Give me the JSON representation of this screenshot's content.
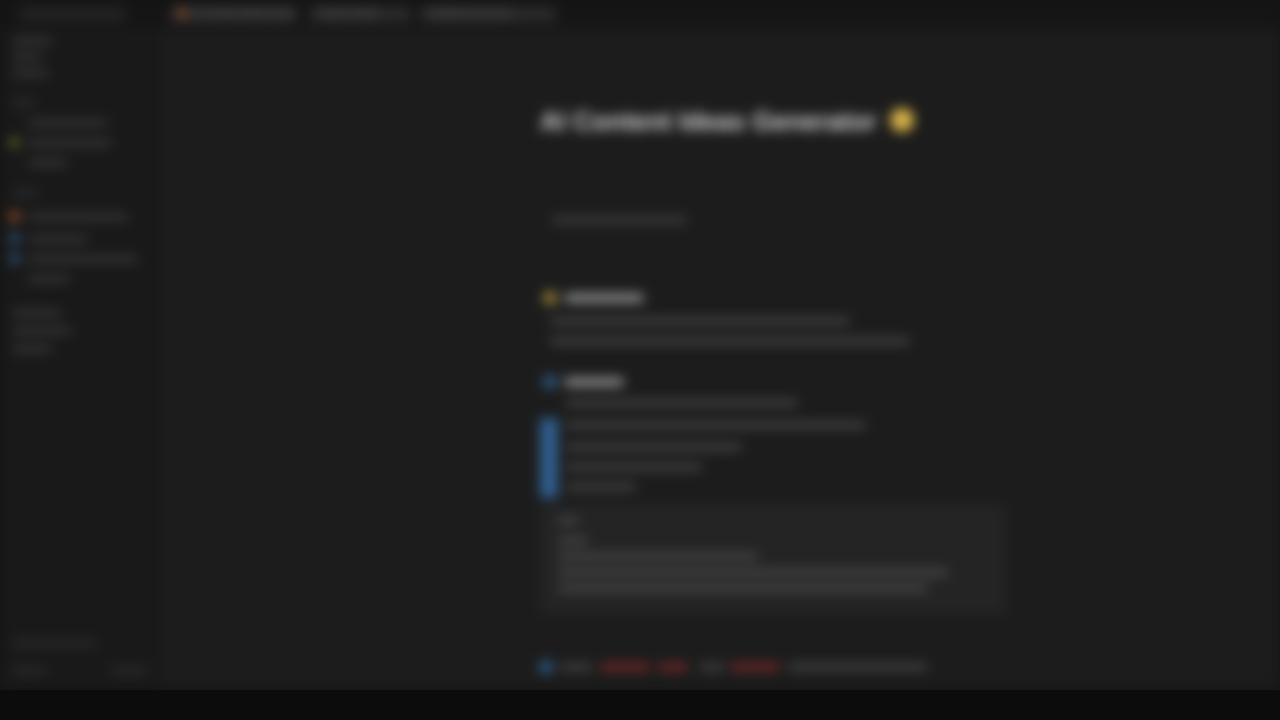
{
  "window": {
    "tabs": [
      {
        "label": "AI Content Ideas Generator"
      },
      {
        "label": "Project Notes"
      },
      {
        "label": "Untitled Document"
      }
    ]
  },
  "page": {
    "title": "AI Content Ideas Generator"
  },
  "colors": {
    "background": "#1c1c1c",
    "sidebar": "#191919",
    "accent_orange": "#b0542a",
    "accent_yellow": "#d8b34a",
    "accent_blue": "#2f5f8f",
    "accent_red": "#8a2a2a"
  },
  "icons": {
    "title_emoji": "lightbulb-icon",
    "section1_icon": "star-icon",
    "section2_icon": "info-icon"
  }
}
